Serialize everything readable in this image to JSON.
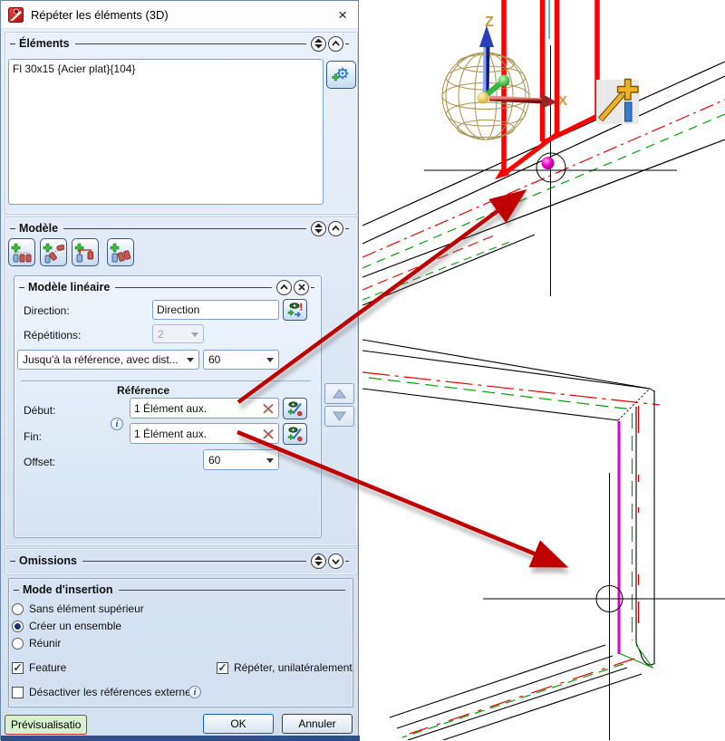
{
  "window": {
    "title": "Répéter les éléments (3D)"
  },
  "icons": {
    "close_glyph": "×",
    "check_glyph": "✓",
    "info_glyph": "i"
  },
  "sections": {
    "elements": {
      "title": "Éléments",
      "items": [
        "Fl 30x15 {Acier plat}{104}"
      ]
    },
    "model": {
      "title": "Modèle"
    },
    "linear": {
      "title": "Modèle linéaire",
      "direction_label": "Direction:",
      "direction_value": "Direction",
      "repetitions_label": "Répétitions:",
      "repetitions_value": "2",
      "mode_value": "Jusqu'à la référence, avec dist...",
      "distance_value": "60",
      "reference_label": "Référence",
      "start_label": "Début:",
      "start_value": "1 Élément aux.",
      "end_label": "Fin:",
      "end_value": "1 Élément aux.",
      "offset_label": "Offset:",
      "offset_value": "60"
    },
    "omissions": {
      "title": "Omissions"
    },
    "insertion": {
      "title": "Mode d'insertion",
      "radios": [
        {
          "label": "Sans élément supérieur",
          "selected": false
        },
        {
          "label": "Créer un ensemble",
          "selected": true
        },
        {
          "label": "Réunir",
          "selected": false
        }
      ],
      "checkboxes": [
        {
          "label": "Feature",
          "checked": true
        },
        {
          "label": "Répéter, unilatéralement",
          "checked": true
        },
        {
          "label": "Désactiver les références externes",
          "checked": false
        }
      ]
    }
  },
  "footer": {
    "preview": "Prévisualisatio",
    "ok": "OK",
    "cancel": "Annuler"
  },
  "viewport": {
    "axis_z": "Z",
    "axis_x": "X"
  },
  "colors": {
    "accent_red": "#c00000",
    "cad_red": "#ff0000",
    "cad_green": "#00a000",
    "cad_magenta": "#dd00cc",
    "cad_cyan": "#38b0d8",
    "gold": "#c0a030"
  }
}
